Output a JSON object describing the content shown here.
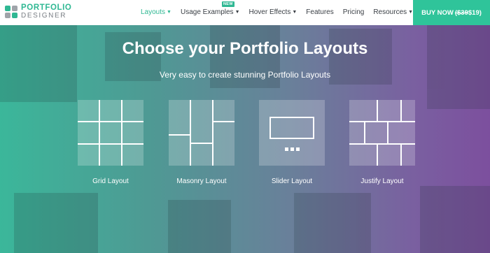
{
  "logo": {
    "line1": "PORTFOLIO",
    "line2": "DESIGNER"
  },
  "nav": {
    "items": [
      {
        "label": "Layouts",
        "active": true,
        "dropdown": true
      },
      {
        "label": "Usage Examples",
        "active": false,
        "dropdown": true,
        "badge": "NEW"
      },
      {
        "label": "Hover Effects",
        "active": false,
        "dropdown": true
      },
      {
        "label": "Features",
        "active": false,
        "dropdown": false
      },
      {
        "label": "Pricing",
        "active": false,
        "dropdown": false
      },
      {
        "label": "Resources",
        "active": false,
        "dropdown": true
      }
    ],
    "buy": {
      "label": "BUY NOW",
      "old_price": "($39",
      "new_price": "$19)"
    }
  },
  "hero": {
    "title": "Choose your Portfolio Layouts",
    "subtitle": "Very easy to create stunning Portfolio Layouts"
  },
  "layouts": [
    {
      "label": "Grid Layout"
    },
    {
      "label": "Masonry Layout"
    },
    {
      "label": "Slider Layout"
    },
    {
      "label": "Justify Layout"
    }
  ],
  "colors": {
    "accent": "#2fb893",
    "buy": "#2fc49a",
    "gradient_start": "#3bb79a",
    "gradient_end": "#7c4f9e"
  }
}
